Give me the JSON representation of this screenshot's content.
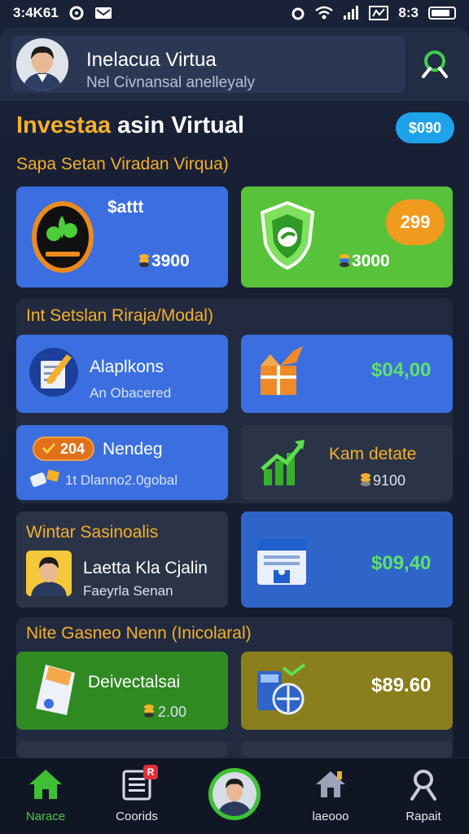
{
  "status_bar": {
    "time": "3:4K61",
    "right_text": "8:3"
  },
  "header": {
    "title": "Inelacua Virtua",
    "subtitle": "Nel Civnansal anelleyaly"
  },
  "main_title": {
    "part1": "Investaa",
    "part2": " asin Virtual"
  },
  "balance_pill": "$090",
  "section1": {
    "heading": "Sapa Setan Viradan Virqua)",
    "cards": [
      {
        "label": "$attt",
        "value": "3900"
      },
      {
        "badge": "299",
        "value": "3000"
      }
    ]
  },
  "section2": {
    "heading": "Int Setslan Riraja/Modal)",
    "cards": [
      {
        "label": "Alaplkons",
        "sub": "An Obacered"
      },
      {
        "value": "$04,00"
      },
      {
        "tag": "204",
        "label": "Nendeg",
        "sub": "1t Dlanno2.0gobal"
      },
      {
        "label": "Kam detate",
        "value": "9100"
      }
    ]
  },
  "section3": {
    "heading": "Wintar Sasinoalis",
    "card": {
      "label": "Laetta Kla Cjalin",
      "sub": "Faeyrla Senan"
    },
    "value_card": {
      "value": "$09,40"
    }
  },
  "section4": {
    "heading": "Nite Gasneo Nenn (Inicolaral)",
    "cards": [
      {
        "label": "Deivectalsai",
        "value": "2.00"
      },
      {
        "value": "$89.60"
      }
    ]
  },
  "bottom_nav": {
    "items": [
      {
        "label": "Narace",
        "icon": "home-icon"
      },
      {
        "label": "Coorids",
        "icon": "list-icon",
        "badge": "R"
      },
      {
        "label": "",
        "icon": "profile-avatar"
      },
      {
        "label": "laeooo",
        "icon": "house-icon"
      },
      {
        "label": "Rapait",
        "icon": "person-icon"
      }
    ]
  },
  "colors": {
    "background": "#1a2238",
    "accent_yellow": "#f5b02a",
    "card_blue": "#3b6fe0",
    "card_green": "#58c23a",
    "card_dark": "#2b3446",
    "card_olive": "#8a7e1d",
    "card_green_dark": "#2f8a22",
    "value_green": "#5fe06a"
  }
}
